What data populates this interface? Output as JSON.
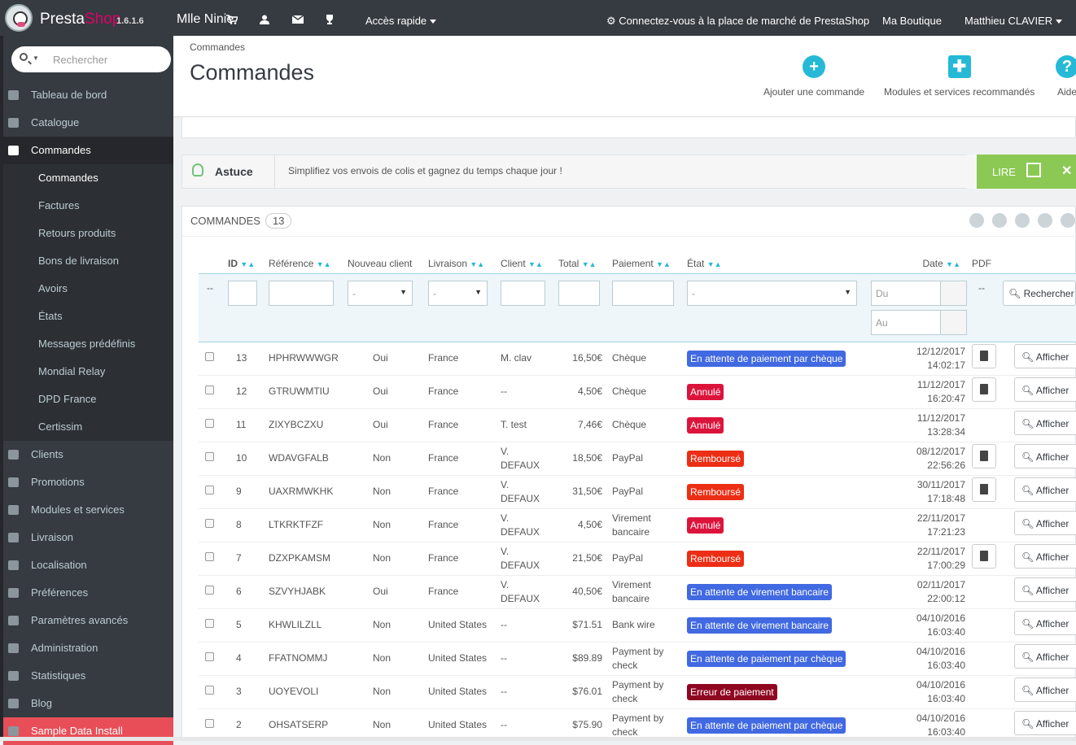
{
  "topbar": {
    "brand_presta": "Presta",
    "brand_shop": "Shop",
    "version": "1.6.1.6",
    "shop_name": "Mlle Ninie",
    "quick_access": "Accès rapide",
    "marketplace": "Connectez-vous à la place de marché de PrestaShop",
    "my_shop": "Ma Boutique",
    "user": "Matthieu CLAVIER"
  },
  "sidebar": {
    "search_placeholder": "Rechercher",
    "items": [
      {
        "label": "Tableau de bord",
        "icon": "dashboard-icon"
      },
      {
        "label": "Catalogue",
        "icon": "book-icon"
      },
      {
        "label": "Commandes",
        "icon": "credit-card-icon",
        "active": true
      },
      {
        "label": "Clients",
        "icon": "users-icon"
      },
      {
        "label": "Promotions",
        "icon": "tag-icon"
      },
      {
        "label": "Modules et services",
        "icon": "puzzle-icon"
      },
      {
        "label": "Livraison",
        "icon": "truck-icon"
      },
      {
        "label": "Localisation",
        "icon": "globe-icon"
      },
      {
        "label": "Préférences",
        "icon": "wrench-icon"
      },
      {
        "label": "Paramètres avancés",
        "icon": "cogs-icon"
      },
      {
        "label": "Administration",
        "icon": "cog-icon"
      },
      {
        "label": "Statistiques",
        "icon": "bar-chart-icon"
      },
      {
        "label": "Blog",
        "icon": "edit-icon"
      },
      {
        "label": "Sample Data Install",
        "icon": "download-icon"
      }
    ],
    "subitems": [
      "Commandes",
      "Factures",
      "Retours produits",
      "Bons de livraison",
      "Avoirs",
      "États",
      "Messages prédéfinis",
      "Mondial Relay",
      "DPD France",
      "Certissim"
    ]
  },
  "header": {
    "breadcrumb": "Commandes",
    "title": "Commandes",
    "toolbar": {
      "add_order": "Ajouter une commande",
      "modules": "Modules et services recommandés",
      "help": "Aide"
    }
  },
  "tip": {
    "label": "Astuce",
    "text": "Simplifiez vos envois de colis et gagnez du temps chaque jour !",
    "read": "LIRE"
  },
  "panel": {
    "title": "COMMANDES",
    "count": "13"
  },
  "columns": {
    "id": "ID",
    "reference": "Référence",
    "new_client": "Nouveau client",
    "delivery": "Livraison",
    "client": "Client",
    "total": "Total",
    "payment": "Paiement",
    "state": "État",
    "date": "Date",
    "pdf": "PDF"
  },
  "filters": {
    "dash": "--",
    "select_default": "-",
    "date_from": "Du",
    "date_to": "Au",
    "search_button": "Rechercher",
    "pdf_dash": "--"
  },
  "action_label": "Afficher",
  "colors": {
    "en_attente_cheque": "#4169e1",
    "en_attente_virement": "#4169e1",
    "annule": "#dc143c",
    "rembourse": "#ec2e15",
    "erreur": "#8f0621"
  },
  "orders": [
    {
      "id": "13",
      "ref": "HPHRWWWGR",
      "new": "Oui",
      "country": "France",
      "client": "M. clav",
      "total": "16,50€",
      "payment": "Chèque",
      "state": "En attente de paiement par chèque",
      "state_color": "#4169e1",
      "date": "12/12/2017",
      "time": "14:02:17",
      "pdf": true
    },
    {
      "id": "12",
      "ref": "GTRUWMTIU",
      "new": "Oui",
      "country": "France",
      "client": "--",
      "total": "4,50€",
      "payment": "Chèque",
      "state": "Annulé",
      "state_color": "#dc143c",
      "date": "11/12/2017",
      "time": "16:20:47",
      "pdf": true
    },
    {
      "id": "11",
      "ref": "ZIXYBCZXU",
      "new": "Oui",
      "country": "France",
      "client": "T. test",
      "total": "7,46€",
      "payment": "Chèque",
      "state": "Annulé",
      "state_color": "#dc143c",
      "date": "11/12/2017",
      "time": "13:28:34",
      "pdf": false
    },
    {
      "id": "10",
      "ref": "WDAVGFALB",
      "new": "Non",
      "country": "France",
      "client": "V. DEFAUX",
      "total": "18,50€",
      "payment": "PayPal",
      "state": "Remboursé",
      "state_color": "#ec2e15",
      "date": "08/12/2017",
      "time": "22:56:26",
      "pdf": true
    },
    {
      "id": "9",
      "ref": "UAXRMWKHK",
      "new": "Non",
      "country": "France",
      "client": "V. DEFAUX",
      "total": "31,50€",
      "payment": "PayPal",
      "state": "Remboursé",
      "state_color": "#ec2e15",
      "date": "30/11/2017",
      "time": "17:18:48",
      "pdf": true
    },
    {
      "id": "8",
      "ref": "LTKRKTFZF",
      "new": "Non",
      "country": "France",
      "client": "V. DEFAUX",
      "total": "4,50€",
      "payment": "Virement bancaire",
      "state": "Annulé",
      "state_color": "#dc143c",
      "date": "22/11/2017",
      "time": "17:21:23",
      "pdf": false
    },
    {
      "id": "7",
      "ref": "DZXPKAMSM",
      "new": "Non",
      "country": "France",
      "client": "V. DEFAUX",
      "total": "21,50€",
      "payment": "PayPal",
      "state": "Remboursé",
      "state_color": "#ec2e15",
      "date": "22/11/2017",
      "time": "17:00:29",
      "pdf": true
    },
    {
      "id": "6",
      "ref": "SZVYHJABK",
      "new": "Oui",
      "country": "France",
      "client": "V. DEFAUX",
      "total": "40,50€",
      "payment": "Virement bancaire",
      "state": "En attente de virement bancaire",
      "state_color": "#4169e1",
      "date": "02/11/2017",
      "time": "22:00:12",
      "pdf": false
    },
    {
      "id": "5",
      "ref": "KHWLILZLL",
      "new": "Non",
      "country": "United States",
      "client": "--",
      "total": "$71.51",
      "payment": "Bank wire",
      "state": "En attente de virement bancaire",
      "state_color": "#4169e1",
      "date": "04/10/2016",
      "time": "16:03:40",
      "pdf": false
    },
    {
      "id": "4",
      "ref": "FFATNOMMJ",
      "new": "Non",
      "country": "United States",
      "client": "--",
      "total": "$89.89",
      "payment": "Payment by check",
      "state": "En attente de paiement par chèque",
      "state_color": "#4169e1",
      "date": "04/10/2016",
      "time": "16:03:40",
      "pdf": false
    },
    {
      "id": "3",
      "ref": "UOYEVOLI",
      "new": "Non",
      "country": "United States",
      "client": "--",
      "total": "$76.01",
      "payment": "Payment by check",
      "state": "Erreur de paiement",
      "state_color": "#8f0621",
      "date": "04/10/2016",
      "time": "16:03:40",
      "pdf": false
    },
    {
      "id": "2",
      "ref": "OHSATSERP",
      "new": "Non",
      "country": "United States",
      "client": "--",
      "total": "$75.90",
      "payment": "Payment by check",
      "state": "En attente de paiement par chèque",
      "state_color": "#4169e1",
      "date": "04/10/2016",
      "time": "16:03:40",
      "pdf": false
    }
  ]
}
